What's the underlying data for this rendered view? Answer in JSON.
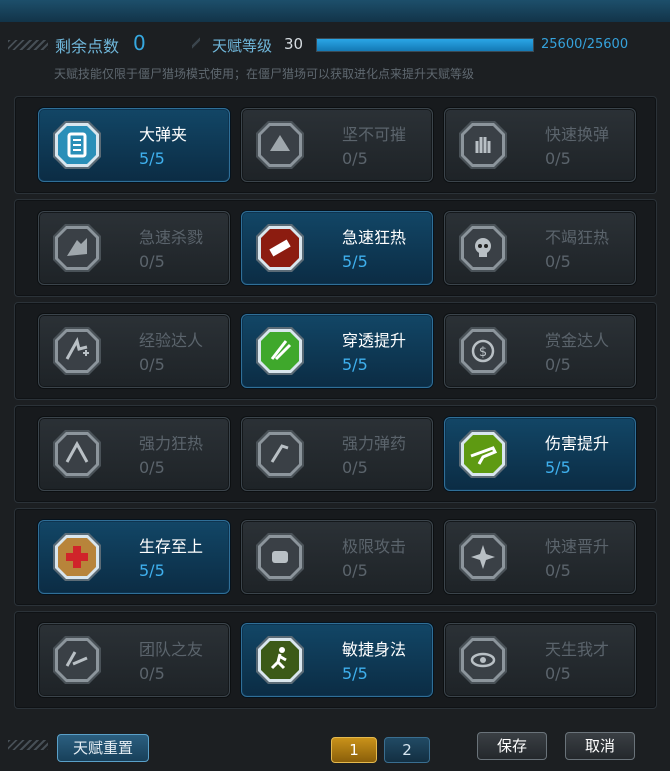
{
  "header": {
    "points_label": "剩余点数",
    "points_value": "0",
    "level_label": "天赋等级",
    "level_value": "30",
    "exp_text": "25600/25600",
    "exp_progress": 1.0,
    "note": "天赋技能仅限于僵尸猎场模式使用；在僵尸猎场可以获取进化点来提升天赋等级"
  },
  "skills": [
    {
      "name": "大弹夹",
      "level": "5/5",
      "active": true,
      "icon": "magazine-icon"
    },
    {
      "name": "坚不可摧",
      "level": "0/5",
      "active": false,
      "icon": "armor-icon"
    },
    {
      "name": "快速换弹",
      "level": "0/5",
      "active": false,
      "icon": "hand-icon"
    },
    {
      "name": "急速杀戮",
      "level": "0/5",
      "active": false,
      "icon": "claw-icon"
    },
    {
      "name": "急速狂热",
      "level": "5/5",
      "active": true,
      "icon": "frenzy-icon"
    },
    {
      "name": "不竭狂热",
      "level": "0/5",
      "active": false,
      "icon": "skull-icon"
    },
    {
      "name": "经验达人",
      "level": "0/5",
      "active": false,
      "icon": "exp-plus-icon"
    },
    {
      "name": "穿透提升",
      "level": "5/5",
      "active": true,
      "icon": "penetration-icon"
    },
    {
      "name": "赏金达人",
      "level": "0/5",
      "active": false,
      "icon": "dollar-icon"
    },
    {
      "name": "强力狂热",
      "level": "0/5",
      "active": false,
      "icon": "power-frenzy-icon"
    },
    {
      "name": "强力弹药",
      "level": "0/5",
      "active": false,
      "icon": "ammo-icon"
    },
    {
      "name": "伤害提升",
      "level": "5/5",
      "active": true,
      "icon": "rifle-icon"
    },
    {
      "name": "生存至上",
      "level": "5/5",
      "active": true,
      "icon": "medical-cross-icon"
    },
    {
      "name": "极限攻击",
      "level": "0/5",
      "active": false,
      "icon": "fist-icon"
    },
    {
      "name": "快速晋升",
      "level": "0/5",
      "active": false,
      "icon": "burst-icon"
    },
    {
      "name": "团队之友",
      "level": "0/5",
      "active": false,
      "icon": "team-gun-icon"
    },
    {
      "name": "敏捷身法",
      "level": "5/5",
      "active": true,
      "icon": "runner-icon"
    },
    {
      "name": "天生我才",
      "level": "0/5",
      "active": false,
      "icon": "eye-icon"
    }
  ],
  "footer": {
    "reset_label": "天赋重置",
    "pages": [
      "1",
      "2"
    ],
    "current_page": "1",
    "save_label": "保存",
    "cancel_label": "取消"
  },
  "colors": {
    "accent_blue": "#36a8e0",
    "page_active": "#c9921a"
  }
}
